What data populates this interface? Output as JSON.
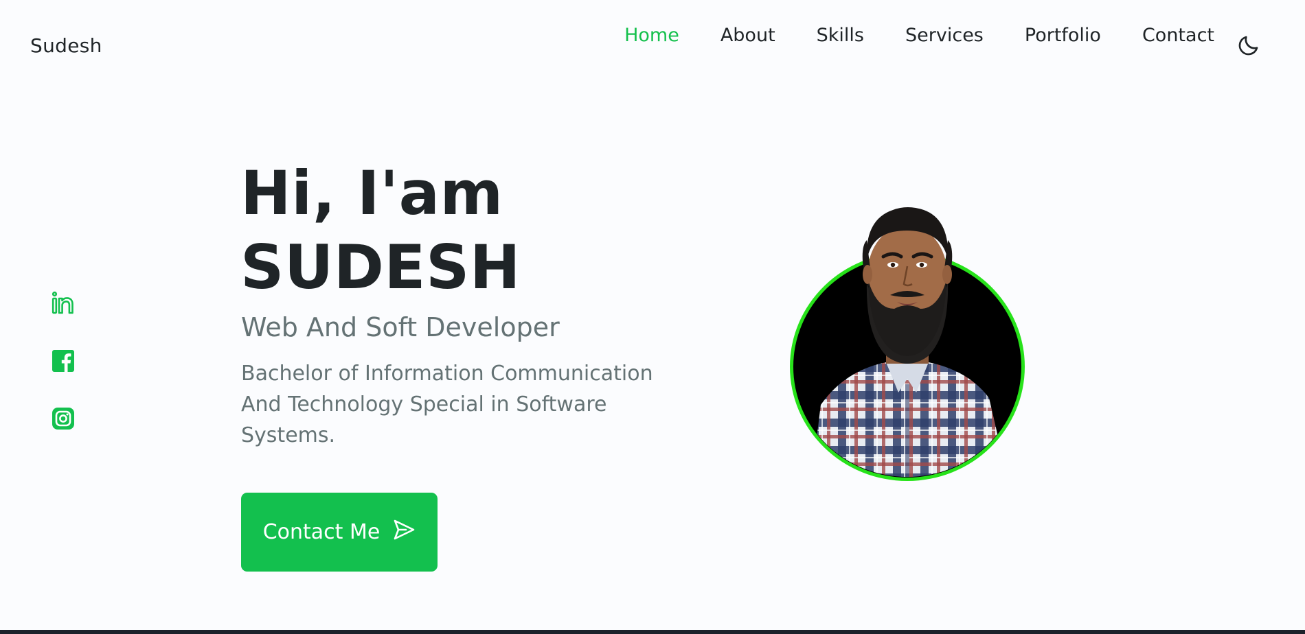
{
  "brand": "Sudesh",
  "nav": {
    "items": [
      {
        "label": "Home",
        "active": true
      },
      {
        "label": "About",
        "active": false
      },
      {
        "label": "Skills",
        "active": false
      },
      {
        "label": "Services",
        "active": false
      },
      {
        "label": "Portfolio",
        "active": false
      },
      {
        "label": "Contact",
        "active": false
      }
    ],
    "theme_toggle_icon": "moon-icon"
  },
  "social": {
    "items": [
      {
        "icon": "linkedin-icon"
      },
      {
        "icon": "facebook-icon"
      },
      {
        "icon": "instagram-icon"
      }
    ]
  },
  "hero": {
    "greeting": "Hi, I'am",
    "name": "SUDESH",
    "subtitle": "Web And Soft Developer",
    "description": "Bachelor of Information Communication And Technology Special in Software Systems.",
    "cta_label": "Contact Me",
    "cta_icon": "send-icon"
  },
  "colors": {
    "accent": "#13c04e",
    "ring": "#27e21a",
    "text": "#1f2427",
    "muted": "#647274",
    "background": "#fbfcfe",
    "bottom_bar": "#1c222b"
  }
}
